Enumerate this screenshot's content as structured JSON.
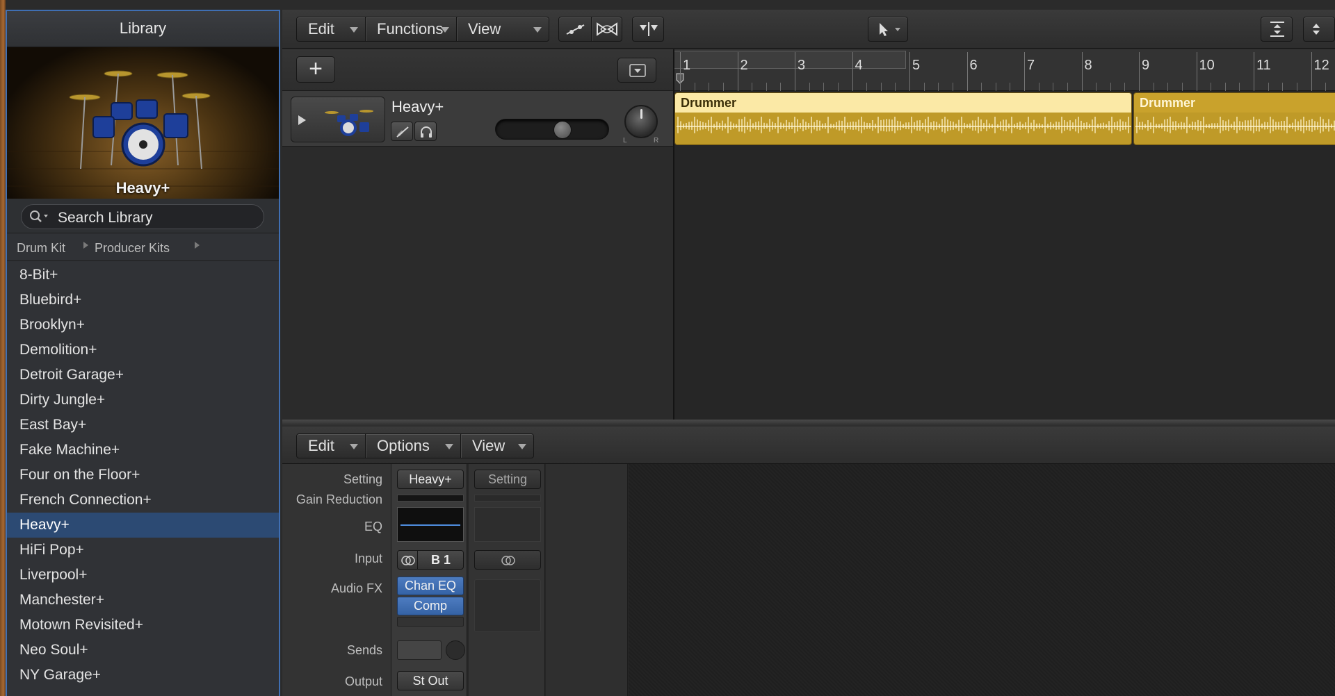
{
  "library": {
    "title": "Library",
    "preview_label": "Heavy+",
    "search_placeholder": "Search Library",
    "breadcrumbs": [
      "Drum Kit",
      "Producer Kits"
    ],
    "items": [
      {
        "label": "8-Bit+",
        "selected": false
      },
      {
        "label": "Bluebird+",
        "selected": false
      },
      {
        "label": "Brooklyn+",
        "selected": false
      },
      {
        "label": "Demolition+",
        "selected": false
      },
      {
        "label": "Detroit Garage+",
        "selected": false
      },
      {
        "label": "Dirty Jungle+",
        "selected": false
      },
      {
        "label": "East Bay+",
        "selected": false
      },
      {
        "label": "Fake Machine+",
        "selected": false
      },
      {
        "label": "Four on the Floor+",
        "selected": false
      },
      {
        "label": "French Connection+",
        "selected": false
      },
      {
        "label": "Heavy+",
        "selected": true
      },
      {
        "label": "HiFi Pop+",
        "selected": false
      },
      {
        "label": "Liverpool+",
        "selected": false
      },
      {
        "label": "Manchester+",
        "selected": false
      },
      {
        "label": "Motown Revisited+",
        "selected": false
      },
      {
        "label": "Neo Soul+",
        "selected": false
      },
      {
        "label": "NY Garage+",
        "selected": false
      }
    ]
  },
  "tracks_toolbar": {
    "menus": [
      "Edit",
      "Functions",
      "View"
    ],
    "icons": [
      "automation-icon",
      "flex-icon",
      "catch-icon",
      "pointer-tool-icon",
      "vertical-zoom-icon",
      "horizontal-zoom-icon"
    ]
  },
  "ruler": {
    "bars": [
      "1",
      "2",
      "3",
      "4",
      "5",
      "6",
      "7",
      "8",
      "9",
      "10",
      "11",
      "12"
    ]
  },
  "track": {
    "name": "Heavy+",
    "volume": 0.62,
    "pan_left": "L",
    "pan_right": "R"
  },
  "regions": [
    {
      "name": "Drummer",
      "selected": true
    },
    {
      "name": "Drummer",
      "selected": false
    }
  ],
  "editor": {
    "menus": [
      "Edit",
      "Options",
      "View"
    ],
    "labels": {
      "setting": "Setting",
      "gain_reduction": "Gain Reduction",
      "eq": "EQ",
      "input": "Input",
      "audio_fx": "Audio FX",
      "sends": "Sends",
      "output": "Output"
    },
    "strip1": {
      "setting": "Heavy+",
      "input": "B 1",
      "fx": [
        "Chan EQ",
        "Comp"
      ],
      "output": "St Out"
    },
    "strip2": {
      "setting": "Setting"
    }
  },
  "colors": {
    "accent": "#3f6fb3",
    "region_header_selected": "#fbe9a6",
    "region_header": "#c9a22c",
    "region_body": "#bf9a28",
    "library_selection": "#2c4a73",
    "fx_slot": "#3f6fb3"
  }
}
